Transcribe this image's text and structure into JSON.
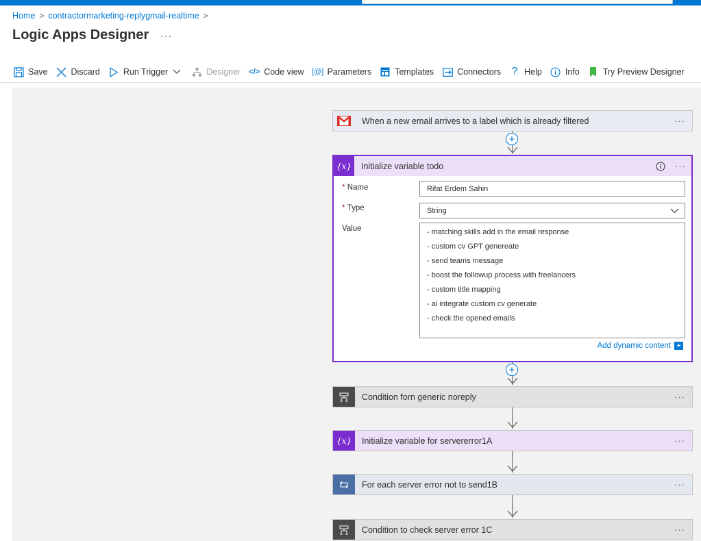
{
  "breadcrumb": {
    "home": "Home",
    "resource": "contractormarketing-replygmail-realtime"
  },
  "page": {
    "title": "Logic Apps Designer",
    "more": "···"
  },
  "toolbar": {
    "save": "Save",
    "discard": "Discard",
    "run_trigger": "Run Trigger",
    "designer": "Designer",
    "code_view": "Code view",
    "parameters": "Parameters",
    "templates": "Templates",
    "connectors": "Connectors",
    "help": "Help",
    "info": "Info",
    "try_preview": "Try Preview Designer"
  },
  "steps": {
    "trigger": {
      "title": "When a new email arrives to a label which is already filtered",
      "more": "···"
    },
    "init_todo": {
      "title": "Initialize variable todo",
      "more": "···",
      "name_label": "Name",
      "name_value": "Rifat Erdem  Sahin",
      "type_label": "Type",
      "type_value": "String",
      "value_label": "Value",
      "value_lines": [
        "- matching skills add in the email response",
        "- custom cv GPT genereate",
        "- send teams message",
        "- boost the followup process with freelancers",
        "- custom title mapping",
        "- ai integrate custom cv generate",
        "- check the opened emails"
      ],
      "dynamic_content": "Add dynamic content",
      "required_mark": "*"
    },
    "cond_noreply": {
      "title": "Condition forn generic noreply",
      "more": "···"
    },
    "init_servererror": {
      "title": "Initialize variable for servererror1A",
      "more": "···"
    },
    "foreach_server": {
      "title": "For each server error not to send1B",
      "more": "···"
    },
    "cond_server": {
      "title": "Condition to check server error 1C",
      "more": "···"
    }
  },
  "icons": {
    "variable_glyph": "{x}",
    "plus": "+"
  },
  "colors": {
    "accent": "#0078d4",
    "variable": "#7a2ecf",
    "condition": "#4a4a4a",
    "foreach": "#4a6fa5",
    "gmail_red": "#d93025"
  }
}
